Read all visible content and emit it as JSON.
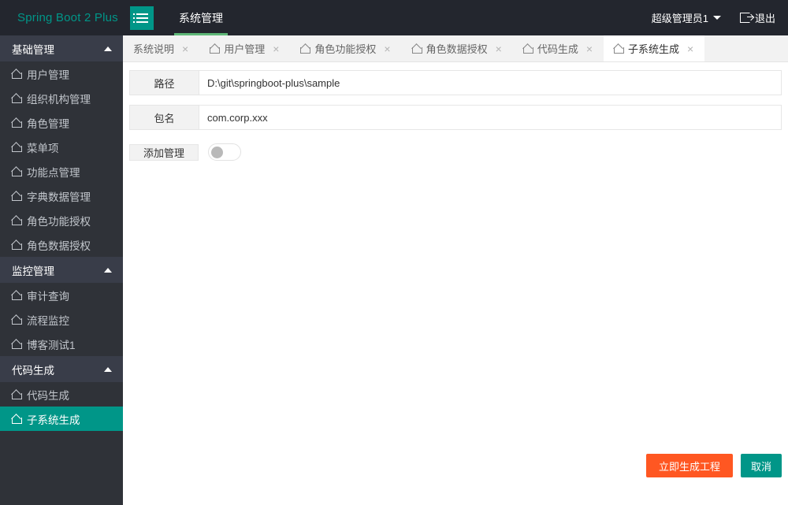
{
  "header": {
    "logo": "Spring Boot 2 Plus",
    "menu_icon": "hamburger-icon",
    "nav_items": [
      {
        "label": "系统管理",
        "active": true
      }
    ],
    "user": {
      "name": "超级管理员1",
      "caret_icon": "chevron-down-icon"
    },
    "logout": {
      "label": "退出",
      "icon": "logout-icon"
    }
  },
  "sidebar": {
    "groups": [
      {
        "label": "基础管理",
        "collapse_icon": "chevron-up-icon",
        "items": [
          {
            "label": "用户管理",
            "icon": "home-icon",
            "active": false
          },
          {
            "label": "组织机构管理",
            "icon": "home-icon",
            "active": false
          },
          {
            "label": "角色管理",
            "icon": "home-icon",
            "active": false
          },
          {
            "label": "菜单项",
            "icon": "home-icon",
            "active": false
          },
          {
            "label": "功能点管理",
            "icon": "home-icon",
            "active": false
          },
          {
            "label": "字典数据管理",
            "icon": "home-icon",
            "active": false
          },
          {
            "label": "角色功能授权",
            "icon": "home-icon",
            "active": false
          },
          {
            "label": "角色数据授权",
            "icon": "home-icon",
            "active": false
          }
        ]
      },
      {
        "label": "监控管理",
        "collapse_icon": "chevron-up-icon",
        "items": [
          {
            "label": "审计查询",
            "icon": "home-icon",
            "active": false
          },
          {
            "label": "流程监控",
            "icon": "home-icon",
            "active": false
          },
          {
            "label": "博客测试1",
            "icon": "home-icon",
            "active": false
          }
        ]
      },
      {
        "label": "代码生成",
        "collapse_icon": "chevron-up-icon",
        "items": [
          {
            "label": "代码生成",
            "icon": "home-icon",
            "active": false
          },
          {
            "label": "子系统生成",
            "icon": "home-icon",
            "active": true
          }
        ]
      }
    ]
  },
  "tabs": [
    {
      "label": "系统说明",
      "has_home_icon": false,
      "active": false,
      "close_icon": "×"
    },
    {
      "label": "用户管理",
      "has_home_icon": true,
      "active": false,
      "close_icon": "×"
    },
    {
      "label": "角色功能授权",
      "has_home_icon": true,
      "active": false,
      "close_icon": "×"
    },
    {
      "label": "角色数据授权",
      "has_home_icon": true,
      "active": false,
      "close_icon": "×"
    },
    {
      "label": "代码生成",
      "has_home_icon": true,
      "active": false,
      "close_icon": "×"
    },
    {
      "label": "子系统生成",
      "has_home_icon": true,
      "active": true,
      "close_icon": "×"
    }
  ],
  "form": {
    "path": {
      "label": "路径",
      "value": "D:\\git\\springboot-plus\\sample",
      "placeholder": ""
    },
    "package": {
      "label": "包名",
      "value": "com.corp.xxx",
      "placeholder": ""
    },
    "add_admin": {
      "label": "添加管理",
      "state": "off"
    }
  },
  "actions": {
    "generate_label": "立即生成工程",
    "cancel_label": "取消"
  },
  "colors": {
    "teal": "#009688",
    "orange": "#FF5722",
    "header_bg": "#23262E",
    "sidebar_bg": "#2F3238",
    "group_bg": "#393D49",
    "nav_underline": "#5FB878",
    "tabbar_bg": "#F2F2F2"
  }
}
